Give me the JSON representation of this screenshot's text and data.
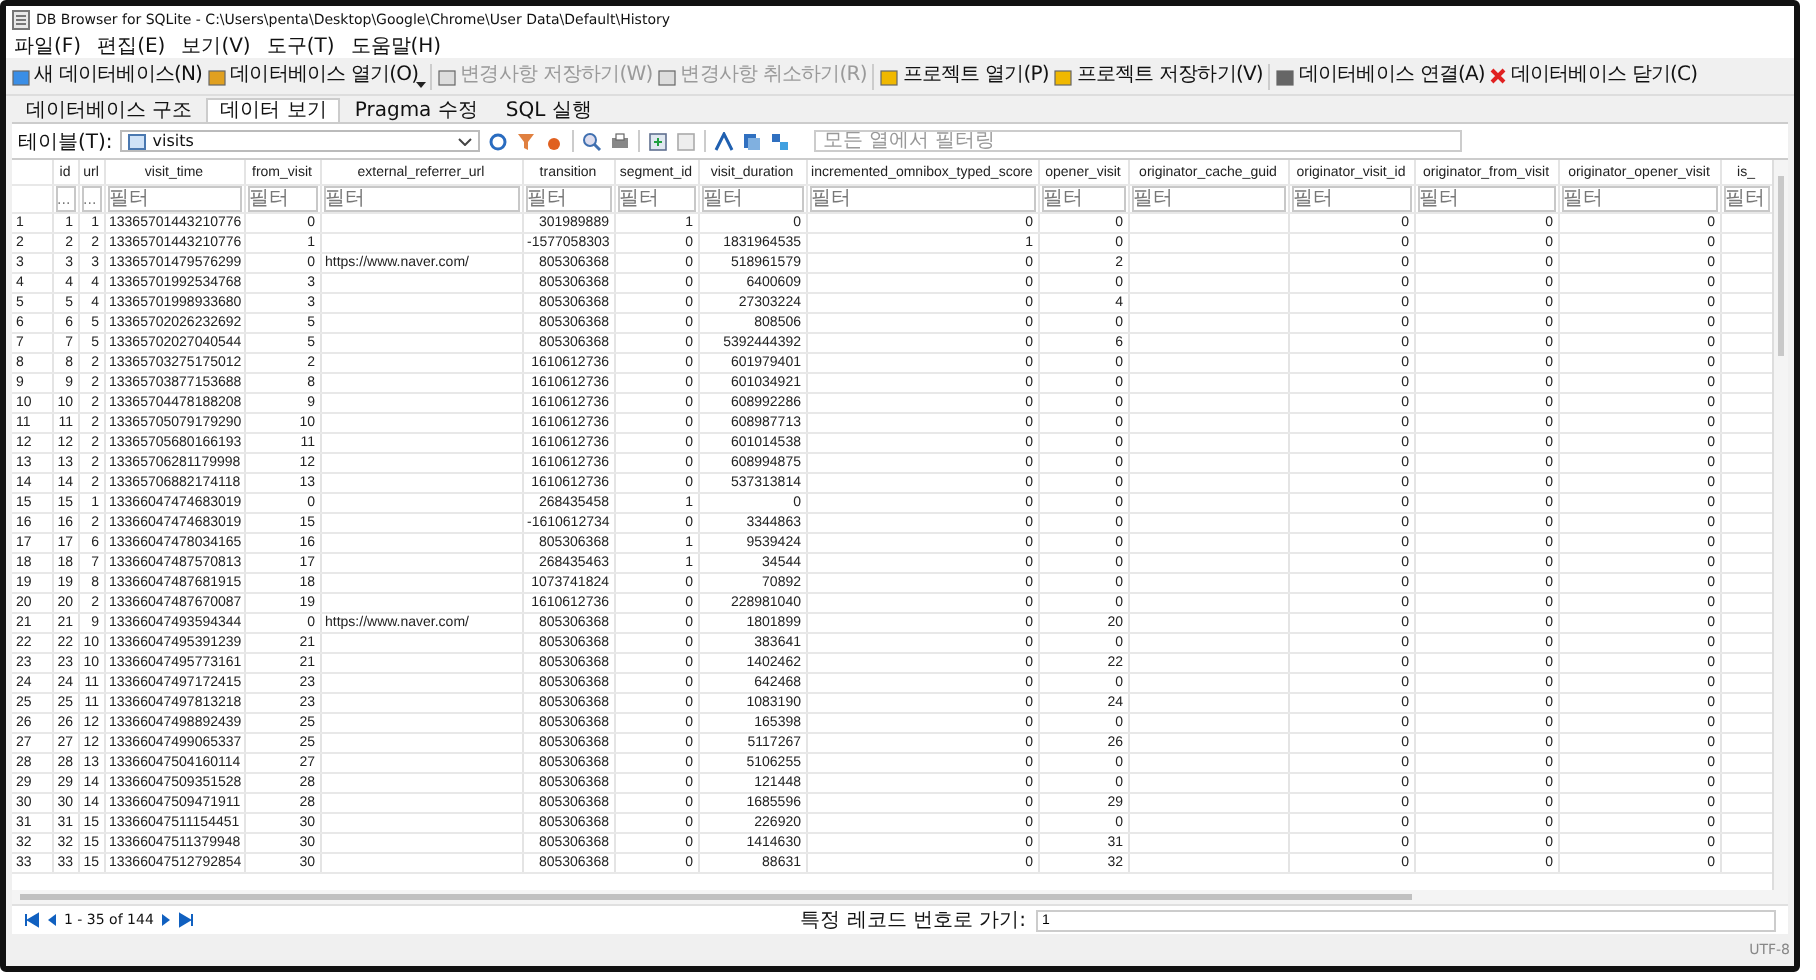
{
  "window": {
    "title": "DB Browser for SQLite - C:\\Users\\penta\\Desktop\\Google\\Chrome\\User Data\\Default\\History"
  },
  "menu": [
    "파일(F)",
    "편집(E)",
    "보기(V)",
    "도구(T)",
    "도움말(H)"
  ],
  "toolbar": [
    {
      "label": "새 데이터베이스(N)",
      "kind": "new",
      "disabled": false
    },
    {
      "label": "데이터베이스 열기(O)",
      "kind": "open",
      "disabled": false,
      "dropdown": true
    },
    {
      "label": "변경사항 저장하기(W)",
      "kind": "save",
      "disabled": true
    },
    {
      "label": "변경사항 취소하기(R)",
      "kind": "revert",
      "disabled": true
    },
    {
      "label": "프로젝트 열기(P)",
      "kind": "project",
      "disabled": false
    },
    {
      "label": "프로젝트 저장하기(V)",
      "kind": "project",
      "disabled": false
    },
    {
      "label": "데이터베이스 연결(A)",
      "kind": "attach",
      "disabled": false
    },
    {
      "label": "데이터베이스 닫기(C)",
      "kind": "close",
      "disabled": false
    }
  ],
  "tabs": [
    {
      "label": "데이터베이스 구조",
      "selected": false
    },
    {
      "label": "데이터 보기",
      "selected": true
    },
    {
      "label": "Pragma 수정",
      "selected": false
    },
    {
      "label": "SQL 실행",
      "selected": false
    }
  ],
  "table_toolbar": {
    "label": "테이블(T):",
    "table": "visits",
    "filter": {
      "placeholder": "모든 열에서 필터링"
    }
  },
  "table": {
    "columns": [
      {
        "label": "id",
        "placeholder": "..."
      },
      {
        "label": "url",
        "placeholder": "..."
      },
      {
        "label": "visit_time",
        "placeholder": "필터"
      },
      {
        "label": "from_visit",
        "placeholder": "필터"
      },
      {
        "label": "external_referrer_url",
        "placeholder": "필터"
      },
      {
        "label": "transition",
        "placeholder": "필터"
      },
      {
        "label": "segment_id",
        "placeholder": "필터"
      },
      {
        "label": "visit_duration",
        "placeholder": "필터"
      },
      {
        "label": "incremented_omnibox_typed_score",
        "placeholder": "필터"
      },
      {
        "label": "opener_visit",
        "placeholder": "필터"
      },
      {
        "label": "originator_cache_guid",
        "placeholder": "필터"
      },
      {
        "label": "originator_visit_id",
        "placeholder": "필터"
      },
      {
        "label": "originator_from_visit",
        "placeholder": "필터"
      },
      {
        "label": "originator_opener_visit",
        "placeholder": "필터"
      },
      {
        "label": "is_",
        "placeholder": "필터"
      }
    ],
    "rows": [
      {
        "n": "1",
        "cells": [
          "1",
          "1",
          "13365701443210776",
          "0",
          null,
          "301989889",
          "1",
          "0",
          "0",
          "0",
          null,
          "0",
          "0",
          "0",
          null
        ]
      },
      {
        "n": "2",
        "cells": [
          "2",
          "2",
          "13365701443210776",
          "1",
          null,
          "-1577058303",
          "0",
          "1831964535",
          "1",
          "0",
          null,
          "0",
          "0",
          "0",
          null
        ]
      },
      {
        "n": "3",
        "cells": [
          "3",
          "3",
          "13365701479576299",
          "0",
          "https://www.naver.com/",
          "805306368",
          "0",
          "518961579",
          "0",
          "2",
          null,
          "0",
          "0",
          "0",
          null
        ]
      },
      {
        "n": "4",
        "cells": [
          "4",
          "4",
          "13365701992534768",
          "3",
          null,
          "805306368",
          "0",
          "6400609",
          "0",
          "0",
          null,
          "0",
          "0",
          "0",
          null
        ]
      },
      {
        "n": "5",
        "cells": [
          "5",
          "4",
          "13365701998933680",
          "3",
          null,
          "805306368",
          "0",
          "27303224",
          "0",
          "4",
          null,
          "0",
          "0",
          "0",
          null
        ]
      },
      {
        "n": "6",
        "cells": [
          "6",
          "5",
          "13365702026232692",
          "5",
          null,
          "805306368",
          "0",
          "808506",
          "0",
          "0",
          null,
          "0",
          "0",
          "0",
          null
        ]
      },
      {
        "n": "7",
        "cells": [
          "7",
          "5",
          "13365702027040544",
          "5",
          null,
          "805306368",
          "0",
          "5392444392",
          "0",
          "6",
          null,
          "0",
          "0",
          "0",
          null
        ]
      },
      {
        "n": "8",
        "cells": [
          "8",
          "2",
          "13365703275175012",
          "2",
          null,
          "1610612736",
          "0",
          "601979401",
          "0",
          "0",
          null,
          "0",
          "0",
          "0",
          null
        ]
      },
      {
        "n": "9",
        "cells": [
          "9",
          "2",
          "13365703877153688",
          "8",
          null,
          "1610612736",
          "0",
          "601034921",
          "0",
          "0",
          null,
          "0",
          "0",
          "0",
          null
        ]
      },
      {
        "n": "10",
        "cells": [
          "10",
          "2",
          "13365704478188208",
          "9",
          null,
          "1610612736",
          "0",
          "608992286",
          "0",
          "0",
          null,
          "0",
          "0",
          "0",
          null
        ]
      },
      {
        "n": "11",
        "cells": [
          "11",
          "2",
          "13365705079179290",
          "10",
          null,
          "1610612736",
          "0",
          "608987713",
          "0",
          "0",
          null,
          "0",
          "0",
          "0",
          null
        ]
      },
      {
        "n": "12",
        "cells": [
          "12",
          "2",
          "13365705680166193",
          "11",
          null,
          "1610612736",
          "0",
          "601014538",
          "0",
          "0",
          null,
          "0",
          "0",
          "0",
          null
        ]
      },
      {
        "n": "13",
        "cells": [
          "13",
          "2",
          "13365706281179998",
          "12",
          null,
          "1610612736",
          "0",
          "608994875",
          "0",
          "0",
          null,
          "0",
          "0",
          "0",
          null
        ]
      },
      {
        "n": "14",
        "cells": [
          "14",
          "2",
          "13365706882174118",
          "13",
          null,
          "1610612736",
          "0",
          "537313814",
          "0",
          "0",
          null,
          "0",
          "0",
          "0",
          null
        ]
      },
      {
        "n": "15",
        "cells": [
          "15",
          "1",
          "13366047474683019",
          "0",
          null,
          "268435458",
          "1",
          "0",
          "0",
          "0",
          null,
          "0",
          "0",
          "0",
          null
        ]
      },
      {
        "n": "16",
        "cells": [
          "16",
          "2",
          "13366047474683019",
          "15",
          null,
          "-1610612734",
          "0",
          "3344863",
          "0",
          "0",
          null,
          "0",
          "0",
          "0",
          null
        ]
      },
      {
        "n": "17",
        "cells": [
          "17",
          "6",
          "13366047478034165",
          "16",
          null,
          "805306368",
          "1",
          "9539424",
          "0",
          "0",
          null,
          "0",
          "0",
          "0",
          null
        ]
      },
      {
        "n": "18",
        "cells": [
          "18",
          "7",
          "13366047487570813",
          "17",
          null,
          "268435463",
          "1",
          "34544",
          "0",
          "0",
          null,
          "0",
          "0",
          "0",
          null
        ]
      },
      {
        "n": "19",
        "cells": [
          "19",
          "8",
          "13366047487681915",
          "18",
          null,
          "1073741824",
          "0",
          "70892",
          "0",
          "0",
          null,
          "0",
          "0",
          "0",
          null
        ]
      },
      {
        "n": "20",
        "cells": [
          "20",
          "2",
          "13366047487670087",
          "19",
          null,
          "1610612736",
          "0",
          "228981040",
          "0",
          "0",
          null,
          "0",
          "0",
          "0",
          null
        ]
      },
      {
        "n": "21",
        "cells": [
          "21",
          "9",
          "13366047493594344",
          "0",
          "https://www.naver.com/",
          "805306368",
          "0",
          "1801899",
          "0",
          "20",
          null,
          "0",
          "0",
          "0",
          null
        ]
      },
      {
        "n": "22",
        "cells": [
          "22",
          "10",
          "13366047495391239",
          "21",
          null,
          "805306368",
          "0",
          "383641",
          "0",
          "0",
          null,
          "0",
          "0",
          "0",
          null
        ]
      },
      {
        "n": "23",
        "cells": [
          "23",
          "10",
          "13366047495773161",
          "21",
          null,
          "805306368",
          "0",
          "1402462",
          "0",
          "22",
          null,
          "0",
          "0",
          "0",
          null
        ]
      },
      {
        "n": "24",
        "cells": [
          "24",
          "11",
          "13366047497172415",
          "23",
          null,
          "805306368",
          "0",
          "642468",
          "0",
          "0",
          null,
          "0",
          "0",
          "0",
          null
        ]
      },
      {
        "n": "25",
        "cells": [
          "25",
          "11",
          "13366047497813218",
          "23",
          null,
          "805306368",
          "0",
          "1083190",
          "0",
          "24",
          null,
          "0",
          "0",
          "0",
          null
        ]
      },
      {
        "n": "26",
        "cells": [
          "26",
          "12",
          "13366047498892439",
          "25",
          null,
          "805306368",
          "0",
          "165398",
          "0",
          "0",
          null,
          "0",
          "0",
          "0",
          null
        ]
      },
      {
        "n": "27",
        "cells": [
          "27",
          "12",
          "13366047499065337",
          "25",
          null,
          "805306368",
          "0",
          "5117267",
          "0",
          "26",
          null,
          "0",
          "0",
          "0",
          null
        ]
      },
      {
        "n": "28",
        "cells": [
          "28",
          "13",
          "13366047504160114",
          "27",
          null,
          "805306368",
          "0",
          "5106255",
          "0",
          "0",
          null,
          "0",
          "0",
          "0",
          null
        ]
      },
      {
        "n": "29",
        "cells": [
          "29",
          "14",
          "13366047509351528",
          "28",
          null,
          "805306368",
          "0",
          "121448",
          "0",
          "0",
          null,
          "0",
          "0",
          "0",
          null
        ]
      },
      {
        "n": "30",
        "cells": [
          "30",
          "14",
          "13366047509471911",
          "28",
          null,
          "805306368",
          "0",
          "1685596",
          "0",
          "29",
          null,
          "0",
          "0",
          "0",
          null
        ]
      },
      {
        "n": "31",
        "cells": [
          "31",
          "15",
          "13366047511154451",
          "30",
          null,
          "805306368",
          "0",
          "226920",
          "0",
          "0",
          null,
          "0",
          "0",
          "0",
          null
        ]
      },
      {
        "n": "32",
        "cells": [
          "32",
          "15",
          "13366047511379948",
          "30",
          null,
          "805306368",
          "0",
          "1414630",
          "0",
          "31",
          null,
          "0",
          "0",
          "0",
          null
        ]
      },
      {
        "n": "33",
        "cells": [
          "33",
          "15",
          "13366047512792854",
          "30",
          null,
          "805306368",
          "0",
          "88631",
          "0",
          "32",
          null,
          "0",
          "0",
          "0",
          null
        ]
      }
    ]
  },
  "navigation": {
    "range": "1 - 35 of 144",
    "goto_label": "특정 레코드 번호로 가기:",
    "goto_value": "1"
  },
  "status_bar": {
    "encoding": "UTF-8"
  }
}
